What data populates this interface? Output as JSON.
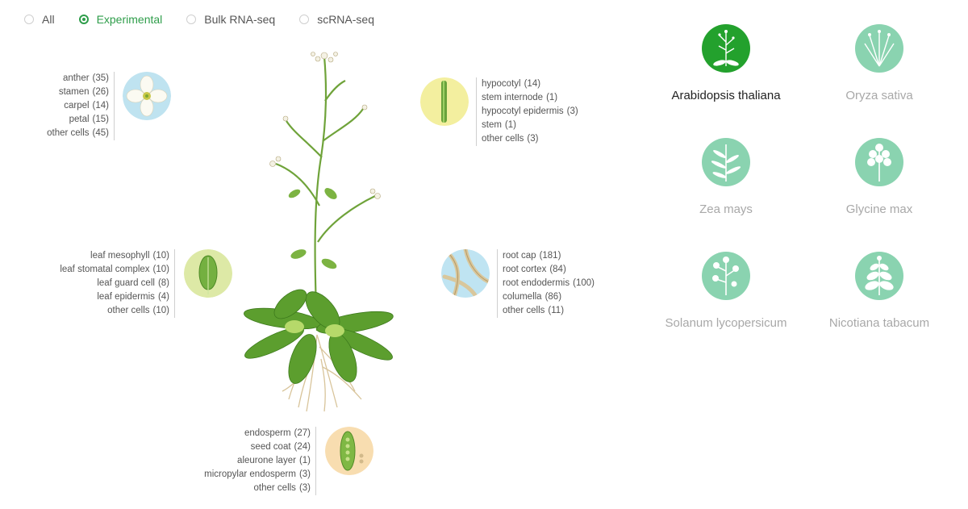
{
  "filters": [
    {
      "label": "All",
      "selected": false
    },
    {
      "label": "Experimental",
      "selected": true
    },
    {
      "label": "Bulk RNA-seq",
      "selected": false
    },
    {
      "label": "scRNA-seq",
      "selected": false
    }
  ],
  "tissues": {
    "flower": {
      "icon": "flower-icon",
      "items": [
        {
          "name": "anther",
          "count": "(35)"
        },
        {
          "name": "stamen",
          "count": "(26)"
        },
        {
          "name": "carpel",
          "count": "(14)"
        },
        {
          "name": "petal",
          "count": "(15)"
        },
        {
          "name": "other cells",
          "count": "(45)"
        }
      ]
    },
    "stem": {
      "icon": "stem-icon",
      "items": [
        {
          "name": "hypocotyl",
          "count": "(14)"
        },
        {
          "name": "stem internode",
          "count": "(1)"
        },
        {
          "name": "hypocotyl epidermis",
          "count": "(3)"
        },
        {
          "name": "stem",
          "count": "(1)"
        },
        {
          "name": "other cells",
          "count": "(3)"
        }
      ]
    },
    "leaf": {
      "icon": "leaf-icon",
      "items": [
        {
          "name": "leaf mesophyll",
          "count": "(10)"
        },
        {
          "name": "leaf stomatal complex",
          "count": "(10)"
        },
        {
          "name": "leaf guard cell",
          "count": "(8)"
        },
        {
          "name": "leaf epidermis",
          "count": "(4)"
        },
        {
          "name": "other cells",
          "count": "(10)"
        }
      ]
    },
    "root": {
      "icon": "root-icon",
      "items": [
        {
          "name": "root cap",
          "count": "(181)"
        },
        {
          "name": "root cortex",
          "count": "(84)"
        },
        {
          "name": "root endodermis",
          "count": "(100)"
        },
        {
          "name": "columella",
          "count": "(86)"
        },
        {
          "name": "other cells",
          "count": "(11)"
        }
      ]
    },
    "seed": {
      "icon": "seed-icon",
      "items": [
        {
          "name": "endosperm",
          "count": "(27)"
        },
        {
          "name": "seed coat",
          "count": "(24)"
        },
        {
          "name": "aleurone layer",
          "count": "(1)"
        },
        {
          "name": "micropylar endosperm",
          "count": "(3)"
        },
        {
          "name": "other cells",
          "count": "(3)"
        }
      ]
    }
  },
  "species": [
    {
      "name": "Arabidopsis thaliana",
      "active": true,
      "icon": "arabidopsis-icon"
    },
    {
      "name": "Oryza sativa",
      "active": false,
      "icon": "rice-icon"
    },
    {
      "name": "Zea mays",
      "active": false,
      "icon": "maize-icon"
    },
    {
      "name": "Glycine max",
      "active": false,
      "icon": "soybean-icon"
    },
    {
      "name": "Solanum lycopersicum",
      "active": false,
      "icon": "tomato-icon"
    },
    {
      "name": "Nicotiana tabacum",
      "active": false,
      "icon": "tobacco-icon"
    }
  ],
  "colors": {
    "accent": "#2e9d4a",
    "species_active": "#23a12d",
    "species_inactive": "#8ad3b0"
  }
}
